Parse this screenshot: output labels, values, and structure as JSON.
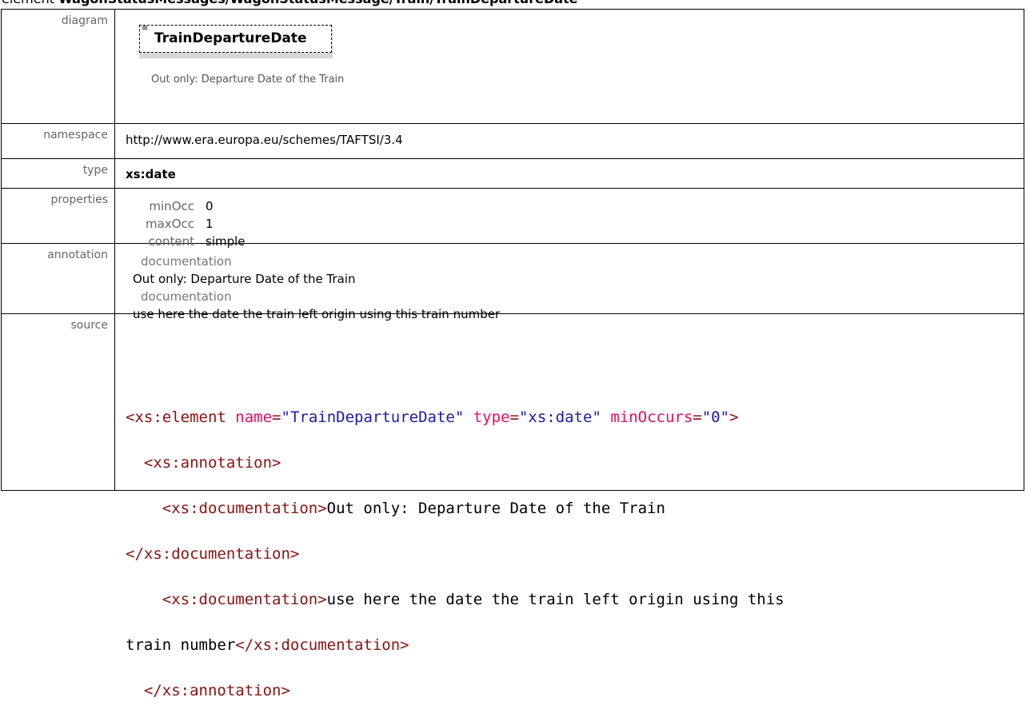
{
  "page": {
    "title_prefix": "element ",
    "title_path": "WagonStatusMessages/WagonStatusMessage/Train/TrainDepartureDate"
  },
  "rows": {
    "diagram": {
      "label": "diagram",
      "element_name": "TrainDepartureDate",
      "doc_text": "Out only: Departure Date of the Train"
    },
    "namespace": {
      "label": "namespace",
      "value": "http://www.era.europa.eu/schemes/TAFTSI/3.4"
    },
    "type": {
      "label": "type",
      "value": "xs:date"
    },
    "properties": {
      "label": "properties",
      "items": [
        {
          "key": "minOcc",
          "value": "0"
        },
        {
          "key": "maxOcc",
          "value": "1"
        },
        {
          "key": "content",
          "value": "simple"
        }
      ]
    },
    "annotation": {
      "label": "annotation",
      "doc_label_1": "documentation",
      "doc_value_1": "Out only: Departure Date of the Train",
      "doc_label_2": "documentation",
      "doc_value_2": "use here the date the train left origin using this train number"
    },
    "source": {
      "label": "source",
      "l1_tag_open": "<xs:element",
      "l1_attr1": " name",
      "l1_val1": "\"TrainDepartureDate\"",
      "l1_attr2": " type",
      "l1_val2": "\"xs:date\"",
      "l1_attr3": " minOccurs",
      "l1_val3": "\"0\"",
      "l1_tag_close": ">",
      "l2": "  <xs:annotation>",
      "l3_open": "    <xs:documentation>",
      "l3_text": "Out only: Departure Date of the Train",
      "l4_close": "</xs:documentation>",
      "l5_open": "    <xs:documentation>",
      "l5_text": "use here the date the train left origin using this",
      "l6_text": "train number",
      "l6_close": "</xs:documentation>",
      "l7": "  </xs:annotation>"
    }
  }
}
